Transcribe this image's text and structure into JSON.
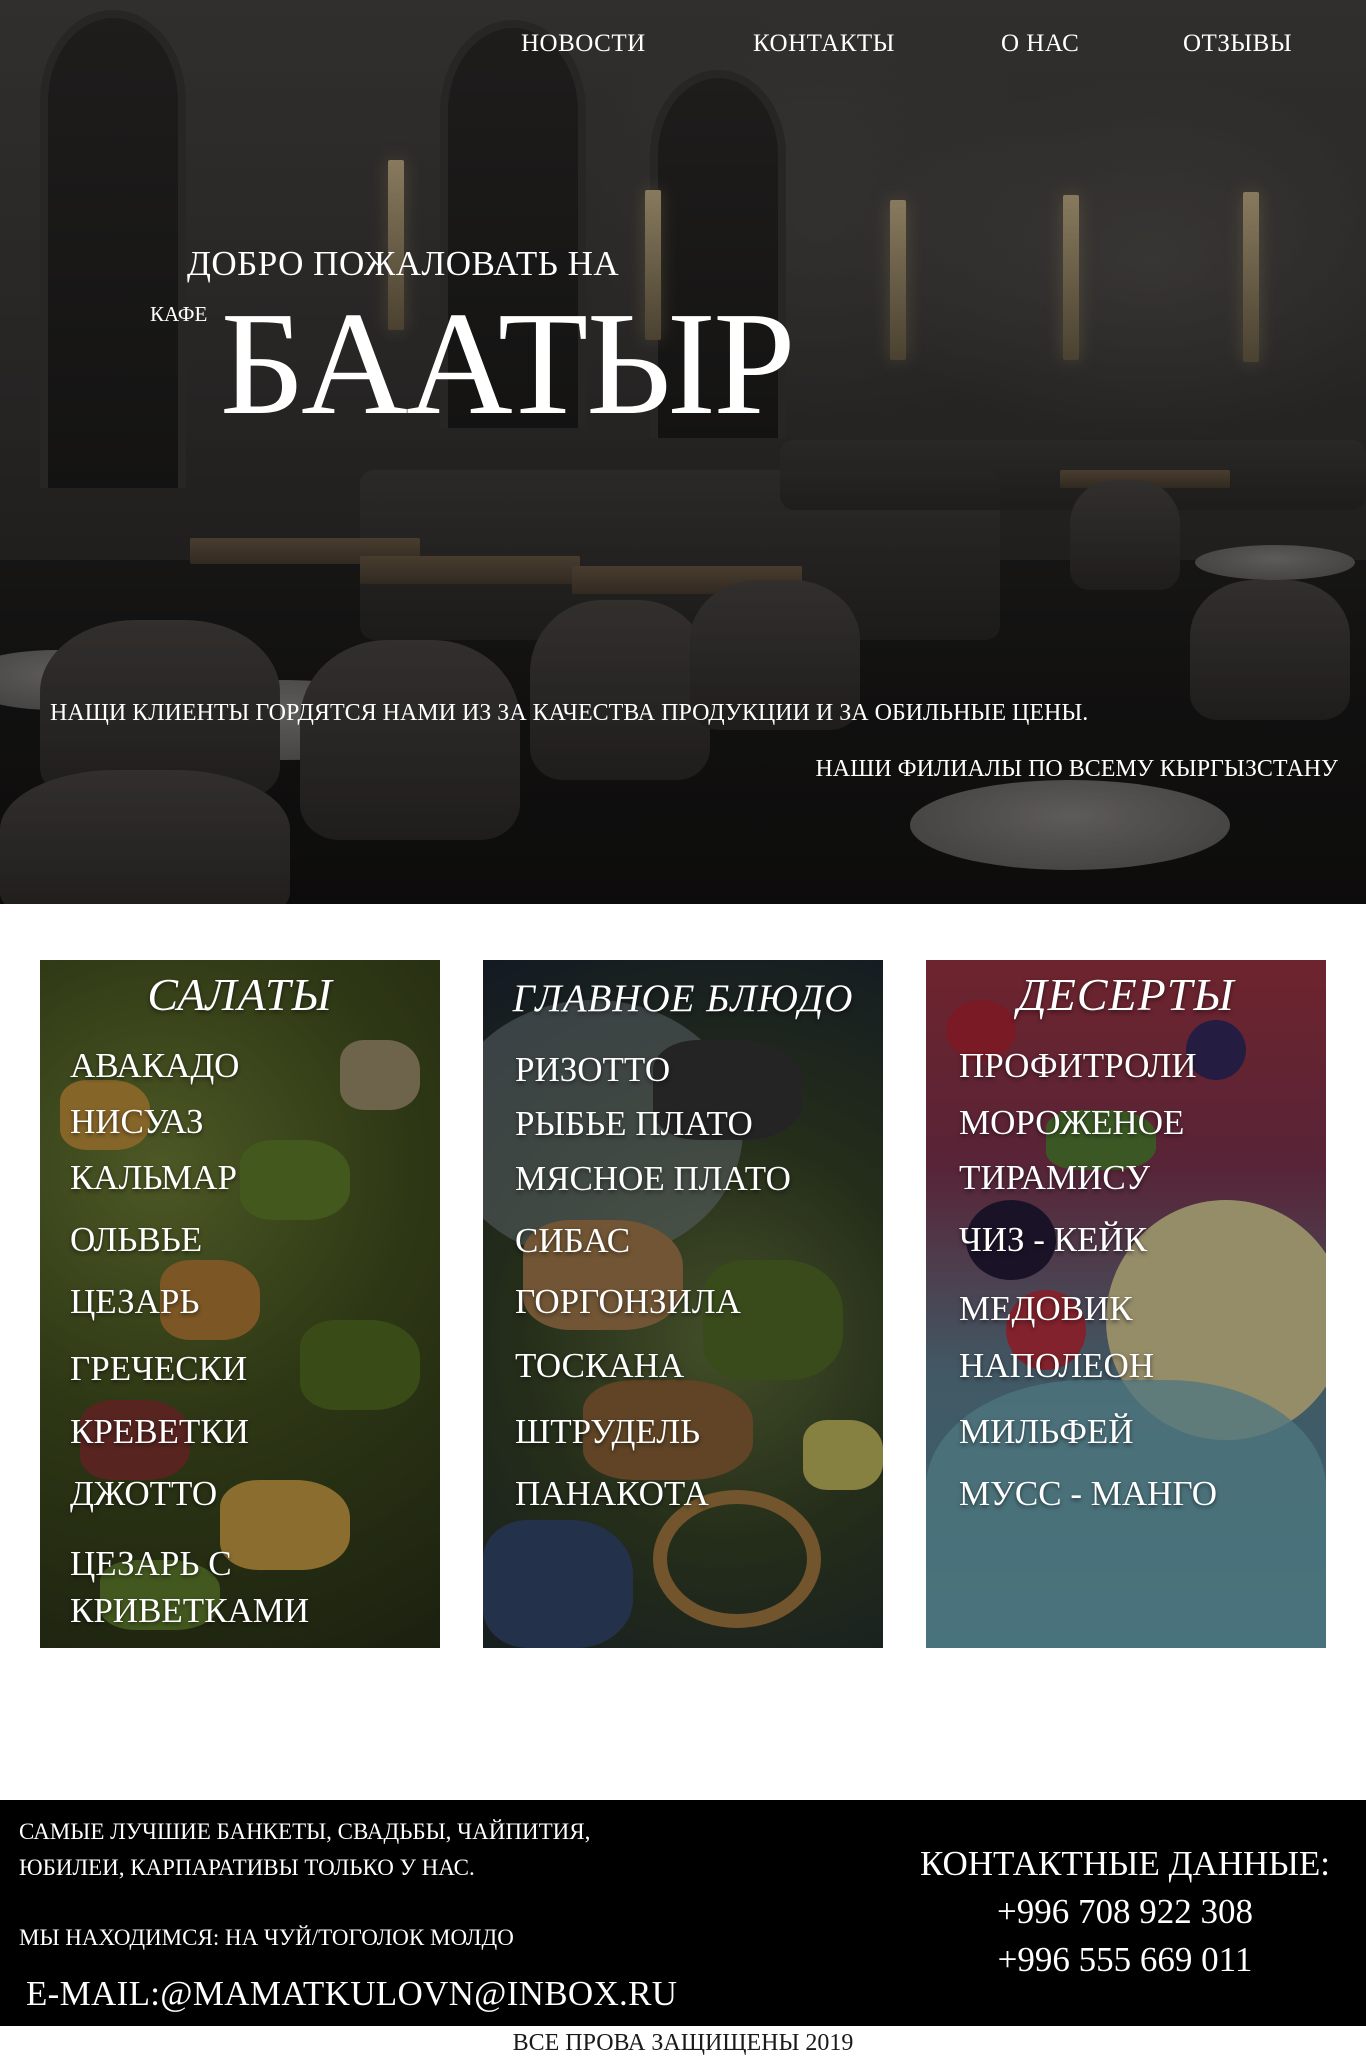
{
  "nav": {
    "items": [
      "НОВОСТИ",
      "КОНТАКТЫ",
      "О НАС",
      "ОТЗЫВЫ"
    ]
  },
  "hero": {
    "welcome": "ДОБРО ПОЖАЛОВАТЬ НА",
    "cafe_label": "КАФЕ",
    "title": "БААТЫР",
    "tagline": "НАЩИ КЛИЕНТЫ ГОРДЯТСЯ НАМИ ИЗ ЗА КАЧЕСТВА ПРОДУКЦИИ И ЗА ОБИЛЬНЫЕ ЦЕНЫ.",
    "branches": "НАШИ ФИЛИАЛЫ ПО ВСЕМУ КЫРГЫЗСТАНУ"
  },
  "menu": {
    "salads": {
      "title": "САЛАТЫ",
      "items": [
        "АВАКАДО",
        "НИСУАЗ",
        "КАЛЬМАР",
        "ОЛЬВЬЕ",
        "ЦЕЗАРЬ",
        "ГРЕЧЕСКИ",
        "КРЕВЕТКИ",
        "ДЖОТТО",
        "ЦЕЗАРЬ С",
        "КРИВЕТКАМИ"
      ]
    },
    "mains": {
      "title": "ГЛАВНОЕ БЛЮДО",
      "items": [
        "РИЗОТТО",
        "РЫБЬЕ ПЛАТО",
        "МЯСНОЕ ПЛАТО",
        "СИБАС",
        "ГОРГОНЗИЛА",
        "ТОСКАНА",
        "ШТРУДЕЛЬ",
        "ПАНАКОТА"
      ]
    },
    "desserts": {
      "title": "ДЕСЕРТЫ",
      "items": [
        "ПРОФИТРОЛИ",
        "МОРОЖЕНОЕ",
        "ТИРАМИСУ",
        "ЧИЗ - КЕЙК",
        "МЕДОВИК",
        "НАПОЛЕОН",
        "МИЛЬФЕЙ",
        "МУСС - МАНГО"
      ]
    }
  },
  "footer": {
    "promo_line1": "САМЫЕ ЛУЧШИЕ БАНКЕТЫ, СВАДЬБЫ, ЧАЙПИТИЯ,",
    "promo_line2": "ЮБИЛЕИ, КАРПАРАТИВЫ ТОЛЬКО У НАС.",
    "address": "МЫ НАХОДИМСЯ: НА ЧУЙ/ТОГОЛОК МОЛДО",
    "email": "E-MAIL:@MAMATKULOVN@INBOX.RU",
    "contacts_heading": "КОНТАКТНЫЕ ДАННЫЕ:",
    "phones": [
      "+996 708 922 308",
      "+996 555 669 011"
    ],
    "copyright": "ВСЕ ПРОВА ЗАЩИЩЕНЫ 2019"
  },
  "colors": {
    "footer_bg": "#000000",
    "text_light": "#ffffff",
    "copyright_text": "#1a1a1a"
  }
}
